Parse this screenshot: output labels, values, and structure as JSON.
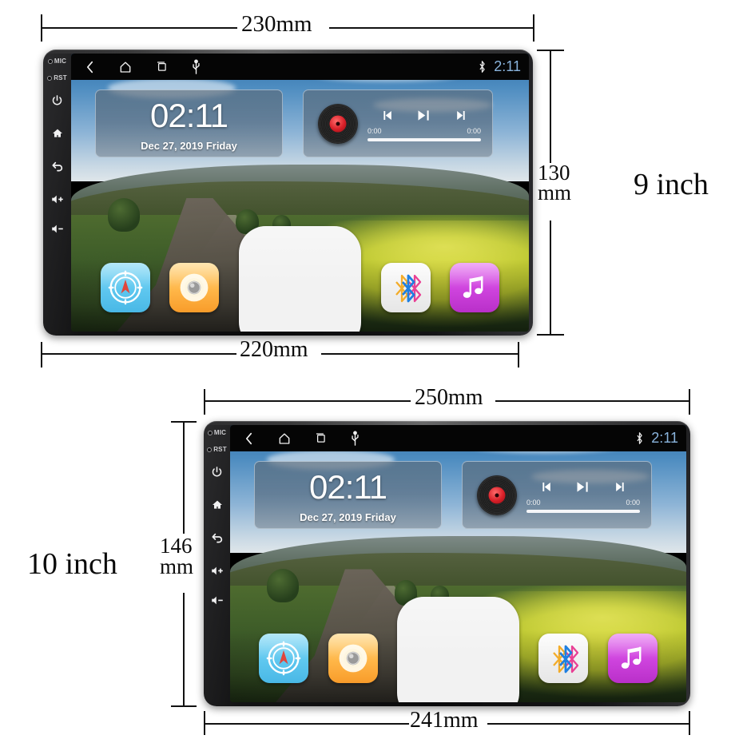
{
  "page": {
    "title": "Car Head Unit Size Comparison",
    "background": "#ffffff"
  },
  "devices": [
    {
      "id": "device-9-inch",
      "size_label": "9 inch",
      "dimensions": {
        "outer_width": "230mm",
        "screen_width": "220mm",
        "height_line1": "130",
        "height_line2": "mm"
      },
      "bezel_buttons": [
        {
          "name": "mic",
          "label": "MIC"
        },
        {
          "name": "reset",
          "label": "RST"
        },
        {
          "name": "power",
          "label": ""
        },
        {
          "name": "home",
          "label": ""
        },
        {
          "name": "back",
          "label": ""
        },
        {
          "name": "volume-up",
          "label": ""
        },
        {
          "name": "volume-down",
          "label": ""
        }
      ],
      "statusbar": {
        "nav_icons": [
          "back-icon",
          "home-icon",
          "recents-icon",
          "usb-icon"
        ],
        "bluetooth_icon": "bluetooth-icon",
        "clock": "2:11",
        "clock_color": "#8ab4dd"
      },
      "clock_widget": {
        "time": "02:11",
        "date": "Dec 27, 2019  Friday"
      },
      "media_widget": {
        "album_icon": "vinyl-record-icon",
        "controls": [
          "previous-track-icon",
          "play-pause-icon",
          "next-track-icon"
        ],
        "elapsed": "0:00",
        "remaining": "0:00"
      },
      "dock_apps": [
        {
          "name": "navigation",
          "icon": "compass-icon",
          "color": "#5ec7ef"
        },
        {
          "name": "radio",
          "icon": "radio-knob-icon",
          "color": "#ffb648"
        },
        {
          "name": "all-apps",
          "icon": "grid-icon",
          "color": "#f2f2f2"
        },
        {
          "name": "bluetooth",
          "icon": "bluetooth-icon",
          "color": "#fbfbfb"
        },
        {
          "name": "music",
          "icon": "music-note-icon",
          "color": "#cf44de"
        }
      ]
    },
    {
      "id": "device-10-inch",
      "size_label": "10 inch",
      "dimensions": {
        "outer_width": "250mm",
        "screen_width": "241mm",
        "height_line1": "146",
        "height_line2": "mm"
      },
      "bezel_buttons": [
        {
          "name": "mic",
          "label": "MIC"
        },
        {
          "name": "reset",
          "label": "RST"
        },
        {
          "name": "power",
          "label": ""
        },
        {
          "name": "home",
          "label": ""
        },
        {
          "name": "back",
          "label": ""
        },
        {
          "name": "volume-up",
          "label": ""
        },
        {
          "name": "volume-down",
          "label": ""
        }
      ],
      "statusbar": {
        "nav_icons": [
          "back-icon",
          "home-icon",
          "recents-icon",
          "usb-icon"
        ],
        "bluetooth_icon": "bluetooth-icon",
        "clock": "2:11",
        "clock_color": "#8ab4dd"
      },
      "clock_widget": {
        "time": "02:11",
        "date": "Dec 27, 2019  Friday"
      },
      "media_widget": {
        "album_icon": "vinyl-record-icon",
        "controls": [
          "previous-track-icon",
          "play-pause-icon",
          "next-track-icon"
        ],
        "elapsed": "0:00",
        "remaining": "0:00"
      },
      "dock_apps": [
        {
          "name": "navigation",
          "icon": "compass-icon",
          "color": "#5ec7ef"
        },
        {
          "name": "radio",
          "icon": "radio-knob-icon",
          "color": "#ffb648"
        },
        {
          "name": "all-apps",
          "icon": "grid-icon",
          "color": "#f2f2f2"
        },
        {
          "name": "bluetooth",
          "icon": "bluetooth-icon",
          "color": "#fbfbfb"
        },
        {
          "name": "music",
          "icon": "music-note-icon",
          "color": "#cf44de"
        }
      ]
    }
  ],
  "grid_colors": [
    "#f04a26",
    "#f5d321",
    "#e01ad8",
    "#44c81f"
  ]
}
